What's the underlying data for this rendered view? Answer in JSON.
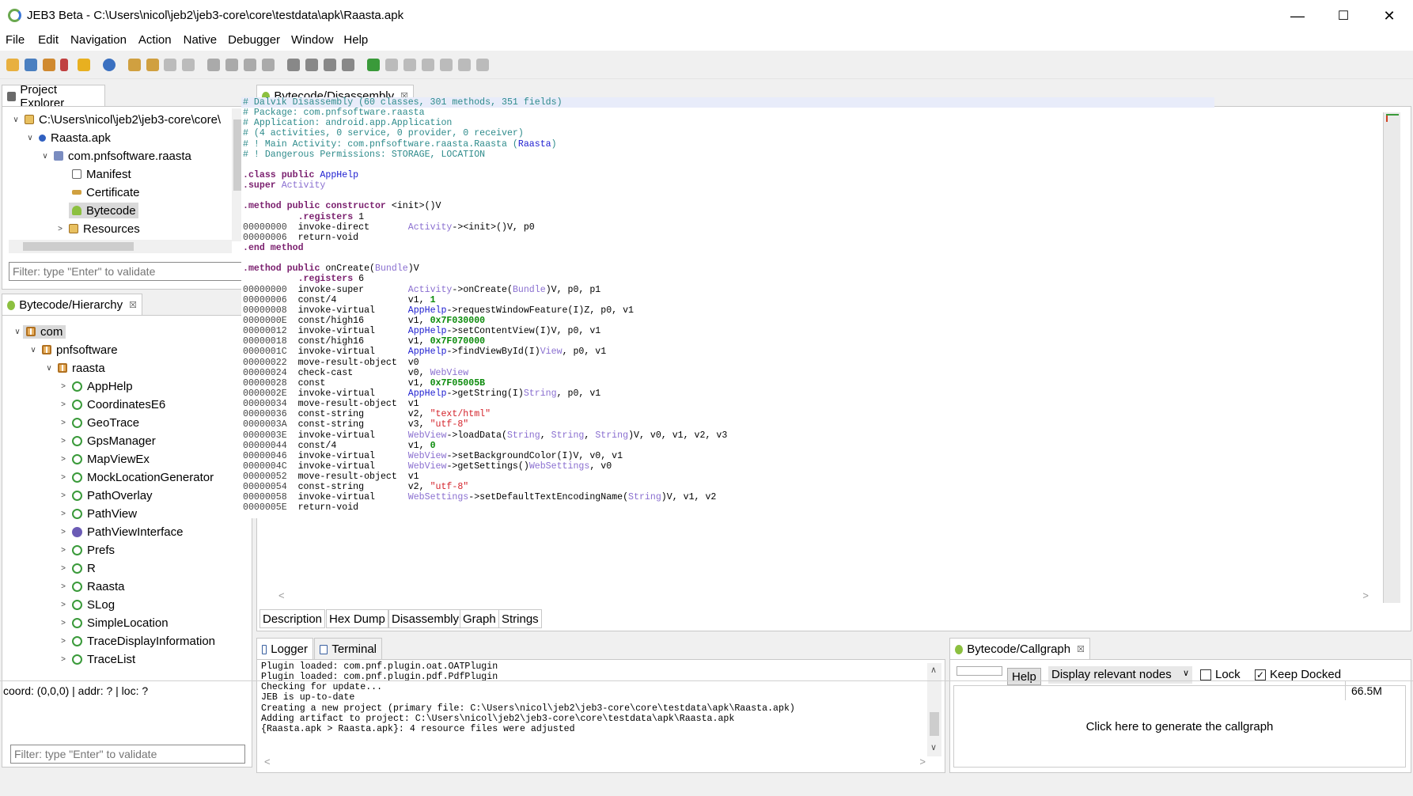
{
  "window": {
    "title": "JEB3 Beta - C:\\Users\\nicol\\jeb2\\jeb3-core\\core\\testdata\\apk\\Raasta.apk",
    "minimize": "—",
    "maximize": "☐",
    "close": "✕"
  },
  "menu": [
    "File",
    "Edit",
    "Navigation",
    "Action",
    "Native",
    "Debugger",
    "Window",
    "Help"
  ],
  "project_explorer": {
    "tab": "Project Explorer",
    "filter_placeholder": "Filter: type \"Enter\" to validate",
    "nodes": [
      {
        "label": "C:\\Users\\nicol\\jeb2\\jeb3-core\\core\\",
        "icon": "folder-open-icon"
      },
      {
        "label": "Raasta.apk",
        "icon": "apk-icon"
      },
      {
        "label": "com.pnfsoftware.raasta",
        "icon": "package-icon"
      },
      {
        "label": "Manifest",
        "icon": "manifest-icon"
      },
      {
        "label": "Certificate",
        "icon": "key-icon"
      },
      {
        "label": "Bytecode",
        "icon": "android-icon",
        "selected": true
      },
      {
        "label": "Resources",
        "icon": "folder-icon"
      }
    ]
  },
  "hierarchy": {
    "tab": "Bytecode/Hierarchy",
    "filter_placeholder": "Filter: type \"Enter\" to validate",
    "root": "com",
    "pkg1": "pnfsoftware",
    "pkg2": "raasta",
    "classes": [
      {
        "name": "AppHelp",
        "kind": "class"
      },
      {
        "name": "CoordinatesE6",
        "kind": "class"
      },
      {
        "name": "GeoTrace",
        "kind": "class"
      },
      {
        "name": "GpsManager",
        "kind": "class"
      },
      {
        "name": "MapViewEx",
        "kind": "class"
      },
      {
        "name": "MockLocationGenerator",
        "kind": "class"
      },
      {
        "name": "PathOverlay",
        "kind": "class"
      },
      {
        "name": "PathView",
        "kind": "class"
      },
      {
        "name": "PathViewInterface",
        "kind": "interface"
      },
      {
        "name": "Prefs",
        "kind": "class"
      },
      {
        "name": "R",
        "kind": "class"
      },
      {
        "name": "Raasta",
        "kind": "class"
      },
      {
        "name": "SLog",
        "kind": "class"
      },
      {
        "name": "SimpleLocation",
        "kind": "class"
      },
      {
        "name": "TraceDisplayInformation",
        "kind": "class"
      },
      {
        "name": "TraceList",
        "kind": "class"
      }
    ]
  },
  "editor": {
    "tab": "Bytecode/Disassembly",
    "bottom_tabs": [
      "Description",
      "Hex Dump",
      "Disassembly",
      "Graph",
      "Strings"
    ],
    "lines": [
      [
        [
          "cm",
          "# Dalvik Disassembly (60 classes, 301 methods, 351 fields)"
        ]
      ],
      [
        [
          "cm",
          "# Package: com.pnfsoftware.raasta"
        ]
      ],
      [
        [
          "cm",
          "# Application: android.app.Application"
        ]
      ],
      [
        [
          "cm",
          "# (4 activities, 0 service, 0 provider, 0 receiver)"
        ]
      ],
      [
        [
          "cm",
          "# ! Main Activity: com.pnfsoftware.raasta.Raasta ("
        ],
        [
          "cn",
          "Raasta"
        ],
        [
          "cm",
          ")"
        ]
      ],
      [
        [
          "cm",
          "# ! Dangerous Permissions: STORAGE, LOCATION"
        ]
      ],
      [],
      [
        [
          "kw",
          ".class public "
        ],
        [
          "cn",
          "AppHelp"
        ]
      ],
      [
        [
          "kw",
          ".super "
        ],
        [
          "ty",
          "Activity"
        ]
      ],
      [],
      [
        [
          "kw",
          ".method public constructor "
        ],
        [
          "",
          "<init>()V"
        ]
      ],
      [
        [
          "kw",
          "          .registers "
        ],
        [
          "",
          "1"
        ]
      ],
      [
        [
          "ad",
          "00000000  "
        ],
        [
          "",
          "invoke-direct       "
        ],
        [
          "ty",
          "Activity"
        ],
        [
          "",
          "-><init>()V, p0"
        ]
      ],
      [
        [
          "ad",
          "00000006  "
        ],
        [
          "",
          "return-void"
        ]
      ],
      [
        [
          "kw",
          ".end method"
        ]
      ],
      [],
      [
        [
          "kw",
          ".method public "
        ],
        [
          "",
          "onCreate("
        ],
        [
          "ty",
          "Bundle"
        ],
        [
          "",
          ")V"
        ]
      ],
      [
        [
          "kw",
          "          .registers "
        ],
        [
          "",
          "6"
        ]
      ],
      [
        [
          "ad",
          "00000000  "
        ],
        [
          "",
          "invoke-super        "
        ],
        [
          "ty",
          "Activity"
        ],
        [
          "",
          "->onCreate("
        ],
        [
          "ty",
          "Bundle"
        ],
        [
          "",
          ")V, p0, p1"
        ]
      ],
      [
        [
          "ad",
          "00000006  "
        ],
        [
          "",
          "const/4             v1, "
        ],
        [
          "nm",
          "1"
        ]
      ],
      [
        [
          "ad",
          "00000008  "
        ],
        [
          "",
          "invoke-virtual      "
        ],
        [
          "cn",
          "AppHelp"
        ],
        [
          "",
          "->requestWindowFeature(I)Z, p0, v1"
        ]
      ],
      [
        [
          "ad",
          "0000000E  "
        ],
        [
          "",
          "const/high16        v1, "
        ],
        [
          "nm",
          "0x7F030000"
        ]
      ],
      [
        [
          "ad",
          "00000012  "
        ],
        [
          "",
          "invoke-virtual      "
        ],
        [
          "cn",
          "AppHelp"
        ],
        [
          "",
          "->setContentView(I)V, p0, v1"
        ]
      ],
      [
        [
          "ad",
          "00000018  "
        ],
        [
          "",
          "const/high16        v1, "
        ],
        [
          "nm",
          "0x7F070000"
        ]
      ],
      [
        [
          "ad",
          "0000001C  "
        ],
        [
          "",
          "invoke-virtual      "
        ],
        [
          "cn",
          "AppHelp"
        ],
        [
          "",
          "->findViewById(I)"
        ],
        [
          "ty",
          "View"
        ],
        [
          "",
          ", p0, v1"
        ]
      ],
      [
        [
          "ad",
          "00000022  "
        ],
        [
          "",
          "move-result-object  v0"
        ]
      ],
      [
        [
          "ad",
          "00000024  "
        ],
        [
          "",
          "check-cast          v0, "
        ],
        [
          "ty",
          "WebView"
        ]
      ],
      [
        [
          "ad",
          "00000028  "
        ],
        [
          "",
          "const               v1, "
        ],
        [
          "nm",
          "0x7F05005B"
        ]
      ],
      [
        [
          "ad",
          "0000002E  "
        ],
        [
          "",
          "invoke-virtual      "
        ],
        [
          "cn",
          "AppHelp"
        ],
        [
          "",
          "->getString(I)"
        ],
        [
          "ty",
          "String"
        ],
        [
          "",
          ", p0, v1"
        ]
      ],
      [
        [
          "ad",
          "00000034  "
        ],
        [
          "",
          "move-result-object  v1"
        ]
      ],
      [
        [
          "ad",
          "00000036  "
        ],
        [
          "",
          "const-string        v2, "
        ],
        [
          "st",
          "\"text/html\""
        ]
      ],
      [
        [
          "ad",
          "0000003A  "
        ],
        [
          "",
          "const-string        v3, "
        ],
        [
          "st",
          "\"utf-8\""
        ]
      ],
      [
        [
          "ad",
          "0000003E  "
        ],
        [
          "",
          "invoke-virtual      "
        ],
        [
          "ty",
          "WebView"
        ],
        [
          "",
          "->loadData("
        ],
        [
          "ty",
          "String"
        ],
        [
          "",
          ", "
        ],
        [
          "ty",
          "String"
        ],
        [
          "",
          ", "
        ],
        [
          "ty",
          "String"
        ],
        [
          "",
          ")V, v0, v1, v2, v3"
        ]
      ],
      [
        [
          "ad",
          "00000044  "
        ],
        [
          "",
          "const/4             v1, "
        ],
        [
          "nm",
          "0"
        ]
      ],
      [
        [
          "ad",
          "00000046  "
        ],
        [
          "",
          "invoke-virtual      "
        ],
        [
          "ty",
          "WebView"
        ],
        [
          "",
          "->setBackgroundColor(I)V, v0, v1"
        ]
      ],
      [
        [
          "ad",
          "0000004C  "
        ],
        [
          "",
          "invoke-virtual      "
        ],
        [
          "ty",
          "WebView"
        ],
        [
          "",
          "->getSettings()"
        ],
        [
          "ty",
          "WebSettings"
        ],
        [
          "",
          ", v0"
        ]
      ],
      [
        [
          "ad",
          "00000052  "
        ],
        [
          "",
          "move-result-object  v1"
        ]
      ],
      [
        [
          "ad",
          "00000054  "
        ],
        [
          "",
          "const-string        v2, "
        ],
        [
          "st",
          "\"utf-8\""
        ]
      ],
      [
        [
          "ad",
          "00000058  "
        ],
        [
          "",
          "invoke-virtual      "
        ],
        [
          "ty",
          "WebSettings"
        ],
        [
          "",
          "->setDefaultTextEncodingName("
        ],
        [
          "ty",
          "String"
        ],
        [
          "",
          ")V, v1, v2"
        ]
      ],
      [
        [
          "ad",
          "0000005E  "
        ],
        [
          "",
          "return-void"
        ]
      ]
    ]
  },
  "logger": {
    "tabs": [
      "Logger",
      "Terminal"
    ],
    "lines": [
      "Plugin loaded: com.pnf.plugin.oat.OATPlugin",
      "Plugin loaded: com.pnf.plugin.pdf.PdfPlugin",
      "Checking for update...",
      "JEB is up-to-date",
      "Creating a new project (primary file: C:\\Users\\nicol\\jeb2\\jeb3-core\\core\\testdata\\apk\\Raasta.apk)",
      "Adding artifact to project: C:\\Users\\nicol\\jeb2\\jeb3-core\\core\\testdata\\apk\\Raasta.apk",
      "{Raasta.apk > Raasta.apk}: 4 resource files were adjusted"
    ]
  },
  "callgraph": {
    "tab": "Bytecode/Callgraph",
    "help": "Help",
    "dropdown": "Display relevant nodes",
    "lock": "Lock",
    "keep_docked": "Keep Docked",
    "lock_checked": false,
    "keep_docked_checked": true,
    "message": "Click here to generate the callgraph"
  },
  "status": {
    "left": "coord: (0,0,0) | addr: ? | loc: ?",
    "right": "66.5M"
  }
}
